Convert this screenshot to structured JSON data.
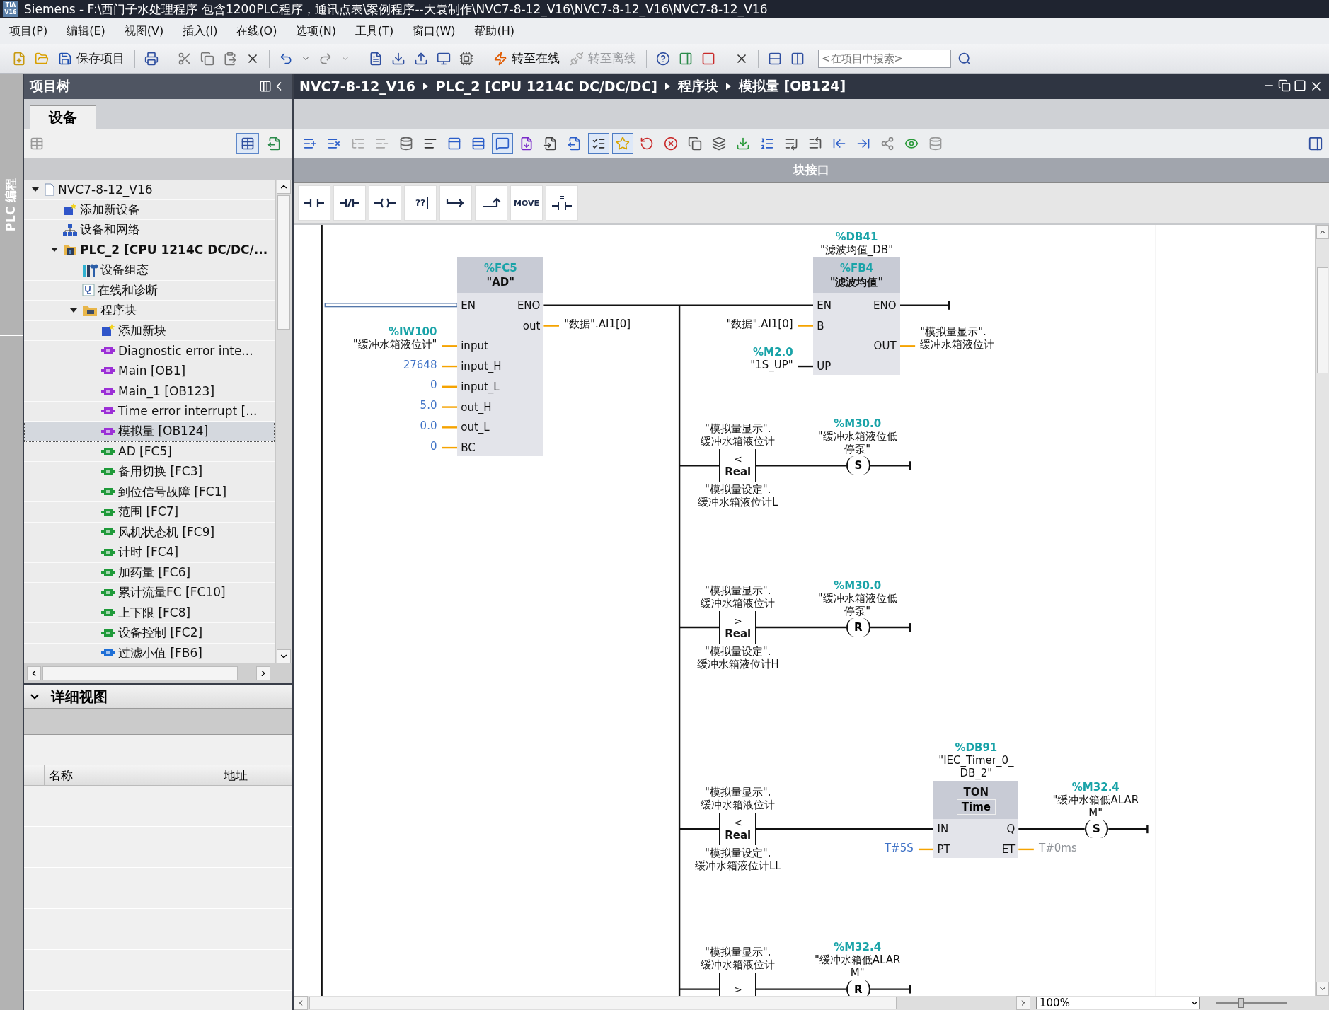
{
  "window": {
    "logo": [
      "TIA",
      "V16"
    ],
    "title": "Siemens  -  F:\\西门子水处理程序 包含1200PLC程序，通讯点表\\案例程序--大袁制作\\NVC7-8-12_V16\\NVC7-8-12_V16\\NVC7-8-12_V16"
  },
  "menu": [
    "项目(P)",
    "编辑(E)",
    "视图(V)",
    "插入(I)",
    "在线(O)",
    "选项(N)",
    "工具(T)",
    "窗口(W)",
    "帮助(H)"
  ],
  "toolbar": {
    "save": "保存项目",
    "go_online": {
      "label": "转至在线",
      "disabled": false
    },
    "go_offline": {
      "label": "转至离线",
      "disabled": true
    },
    "search": {
      "placeholder": "<在项目中搜索>"
    }
  },
  "side_tab": "PLC 编程",
  "project_tree": {
    "title": "项目树",
    "tab": "设备",
    "view_buttons": [
      {
        "on": true
      },
      {
        "on": false
      }
    ],
    "items": [
      {
        "label": "NVC7-8-12_V16",
        "kind": "project",
        "expanded": true,
        "selected": false,
        "children": [
          {
            "label": "添加新设备",
            "kind": "add",
            "selected": false
          },
          {
            "label": "设备和网络",
            "kind": "network",
            "selected": false
          },
          {
            "label": "PLC_2 [CPU 1214C DC/DC/...",
            "kind": "plc",
            "expanded": true,
            "selected": false,
            "children": [
              {
                "label": "设备组态",
                "kind": "config",
                "selected": false
              },
              {
                "label": "在线和诊断",
                "kind": "diag",
                "selected": false
              },
              {
                "label": "程序块",
                "kind": "folder",
                "expanded": true,
                "selected": false,
                "children": [
                  {
                    "label": "添加新块",
                    "kind": "add",
                    "selected": false
                  },
                  {
                    "label": "Diagnostic error inte...",
                    "kind": "ob",
                    "selected": false
                  },
                  {
                    "label": "Main [OB1]",
                    "kind": "ob",
                    "selected": false
                  },
                  {
                    "label": "Main_1 [OB123]",
                    "kind": "ob",
                    "selected": false
                  },
                  {
                    "label": "Time error interrupt [...",
                    "kind": "ob",
                    "selected": false
                  },
                  {
                    "label": "模拟量 [OB124]",
                    "kind": "ob",
                    "selected": true
                  },
                  {
                    "label": "AD [FC5]",
                    "kind": "fc",
                    "selected": false
                  },
                  {
                    "label": "备用切换 [FC3]",
                    "kind": "fc",
                    "selected": false
                  },
                  {
                    "label": "到位信号故障 [FC1]",
                    "kind": "fc",
                    "selected": false
                  },
                  {
                    "label": "范围 [FC7]",
                    "kind": "fc",
                    "selected": false
                  },
                  {
                    "label": "风机状态机 [FC9]",
                    "kind": "fc",
                    "selected": false
                  },
                  {
                    "label": "计时 [FC4]",
                    "kind": "fc",
                    "selected": false
                  },
                  {
                    "label": "加药量 [FC6]",
                    "kind": "fc",
                    "selected": false
                  },
                  {
                    "label": "累计流量FC [FC10]",
                    "kind": "fc",
                    "selected": false
                  },
                  {
                    "label": "上下限 [FC8]",
                    "kind": "fc",
                    "selected": false
                  },
                  {
                    "label": "设备控制 [FC2]",
                    "kind": "fc",
                    "selected": false
                  },
                  {
                    "label": "过滤小值 [FB6]",
                    "kind": "fb",
                    "selected": false
                  }
                ]
              }
            ]
          }
        ]
      }
    ]
  },
  "detail_view": {
    "title": "详细视图",
    "columns": [
      "名称",
      "地址"
    ]
  },
  "editor": {
    "breadcrumb": [
      "NVC7-8-12_V16",
      "PLC_2 [CPU 1214C DC/DC/DC]",
      "程序块",
      "模拟量 [OB124]"
    ],
    "toolbar": [
      {
        "on": false
      },
      {
        "on": false
      },
      {
        "on": false
      },
      {
        "on": false
      },
      {
        "on": false
      },
      {
        "on": false
      },
      {
        "on": false
      },
      {
        "on": false
      },
      {
        "on": true
      },
      {
        "on": false
      },
      {
        "on": false
      },
      {
        "on": false
      },
      {
        "on": true
      },
      {
        "on": true
      },
      {
        "on": false
      },
      {
        "on": false
      },
      {
        "on": false
      },
      {
        "on": false
      },
      {
        "on": false
      },
      {
        "on": false
      },
      {
        "on": false
      },
      {
        "on": false
      },
      {
        "on": false
      },
      {
        "on": false
      },
      {
        "on": false
      },
      {
        "on": false
      },
      {
        "on": false
      }
    ],
    "interface_bar": "块接口",
    "palette": [
      {
        "kind": "no_contact"
      },
      {
        "kind": "nc_contact"
      },
      {
        "kind": "coil"
      },
      {
        "kind": "empty_box",
        "label": "??"
      },
      {
        "kind": "open_branch"
      },
      {
        "kind": "close_branch"
      },
      {
        "kind": "text",
        "label": "MOVE"
      },
      {
        "kind": "compare"
      }
    ],
    "blocks": [
      {
        "number": "%FC5",
        "name": "\"AD\"",
        "rows": [
          {
            "left": "EN",
            "right": "ENO"
          },
          {
            "right": "out",
            "right_operand": {
              "kind": "tag",
              "lines": [
                "\"数据\".AI1[0]"
              ]
            }
          },
          {
            "left": "input",
            "left_operand": {
              "kind": "tag",
              "address": "%IW100",
              "lines": [
                "\"缓冲水箱液位计\""
              ]
            }
          },
          {
            "left": "input_H",
            "left_operand": {
              "kind": "constant",
              "lines": [
                "27648"
              ]
            }
          },
          {
            "left": "input_L",
            "left_operand": {
              "kind": "constant",
              "lines": [
                "0"
              ]
            }
          },
          {
            "left": "out_H",
            "left_operand": {
              "kind": "constant",
              "lines": [
                "5.0"
              ]
            }
          },
          {
            "left": "out_L",
            "left_operand": {
              "kind": "constant",
              "lines": [
                "0.0"
              ]
            }
          },
          {
            "left": "BC",
            "left_operand": {
              "kind": "constant",
              "lines": [
                "0"
              ]
            }
          }
        ]
      },
      {
        "instance_address": "%DB41",
        "instance": [
          "\"滤波均值_DB\""
        ],
        "number": "%FB4",
        "name": "\"滤波均值\"",
        "rows": [
          {
            "left": "EN",
            "right": "ENO"
          },
          {
            "left": "B",
            "left_operand": {
              "kind": "tag",
              "lines": [
                "\"数据\".AI1[0]"
              ]
            }
          },
          {
            "right": "OUT",
            "right_operand": {
              "kind": "tag",
              "lines": [
                "\"模拟量显示\".",
                "缓冲水箱液位计"
              ]
            }
          },
          {
            "left": "UP",
            "left_operand": {
              "kind": "bool",
              "address": "%M2.0",
              "lines": [
                "\"1S_UP\""
              ]
            }
          }
        ]
      }
    ],
    "rungs": [
      {
        "contact": {
          "operator": "<",
          "type": "Real",
          "above": [
            "\"模拟量显示\".",
            "缓冲水箱液位计"
          ],
          "below": [
            "\"模拟量设定\".",
            "缓冲水箱液位计L"
          ]
        },
        "coil": {
          "label": "S",
          "address": "%M30.0",
          "lines": [
            "\"缓冲水箱液位低",
            "停泵\""
          ]
        }
      },
      {
        "contact": {
          "operator": ">",
          "type": "Real",
          "above": [
            "\"模拟量显示\".",
            "缓冲水箱液位计"
          ],
          "below": [
            "\"模拟量设定\".",
            "缓冲水箱液位计H"
          ]
        },
        "coil": {
          "label": "R",
          "address": "%M30.0",
          "lines": [
            "\"缓冲水箱液位低",
            "停泵\""
          ]
        }
      },
      {
        "contact": {
          "operator": "<",
          "type": "Real",
          "above": [
            "\"模拟量显示\".",
            "缓冲水箱液位计"
          ],
          "below": [
            "\"模拟量设定\".",
            "缓冲水箱液位计LL"
          ]
        },
        "timer": {
          "instance_address": "%DB91",
          "instance": [
            "\"IEC_Timer_0_",
            "DB_2\""
          ],
          "name": "TON",
          "type": "Time",
          "rows": [
            {
              "left": "IN",
              "right": "Q"
            },
            {
              "left": "PT",
              "right": "ET",
              "left_operand": {
                "kind": "constant",
                "lines": [
                  "T#5S"
                ]
              },
              "right_operand": {
                "kind": "value",
                "lines": [
                  "T#0ms"
                ]
              }
            }
          ]
        },
        "coil": {
          "label": "S",
          "address": "%M32.4",
          "lines": [
            "\"缓冲水箱低ALAR",
            "M\""
          ]
        }
      },
      {
        "contact": {
          "operator": ">",
          "above": [
            "\"模拟量显示\".",
            "缓冲水箱液位计"
          ]
        },
        "coil": {
          "label": "R",
          "address": "%M32.4",
          "lines": [
            "\"缓冲水箱低ALAR",
            "M\""
          ]
        }
      }
    ],
    "zoom": "100%",
    "zoom_slider": {
      "level": 0.35
    }
  }
}
